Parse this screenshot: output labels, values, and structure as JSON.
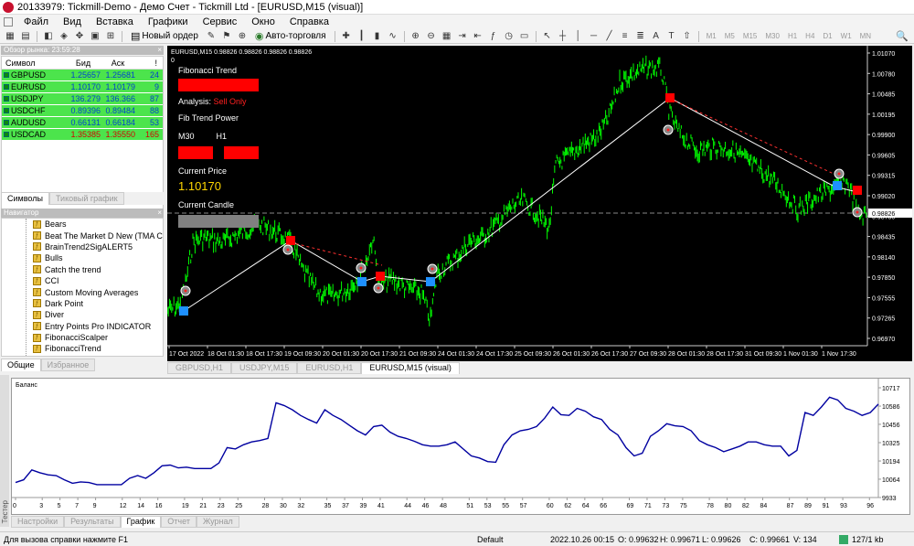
{
  "window": {
    "title": "20133979: Tickmill-Demo - Демо Счет - Tickmill Ltd - [EURUSD,M15 (visual)]"
  },
  "menu": [
    "Файл",
    "Вид",
    "Вставка",
    "Графики",
    "Сервис",
    "Окно",
    "Справка"
  ],
  "toolbar": {
    "new_order": "Новый ордер",
    "auto_trading": "Авто-торговля",
    "timeframes": [
      "M1",
      "M5",
      "M15",
      "M30",
      "H1",
      "H4",
      "D1",
      "W1",
      "MN"
    ]
  },
  "market_watch": {
    "header": "Обзор рынка: 23:59:28",
    "columns": [
      "Символ",
      "Бид",
      "Аск",
      "!"
    ],
    "rows": [
      {
        "symbol": "GBPUSD",
        "bid": "1.25657",
        "ask": "1.25681",
        "spread": "24",
        "dir": "up"
      },
      {
        "symbol": "EURUSD",
        "bid": "1.10170",
        "ask": "1.10179",
        "spread": "9",
        "dir": "up"
      },
      {
        "symbol": "USDJPY",
        "bid": "136.279",
        "ask": "136.366",
        "spread": "87",
        "dir": "up"
      },
      {
        "symbol": "USDCHF",
        "bid": "0.89396",
        "ask": "0.89484",
        "spread": "88",
        "dir": "up"
      },
      {
        "symbol": "AUDUSD",
        "bid": "0.66131",
        "ask": "0.66184",
        "spread": "53",
        "dir": "up"
      },
      {
        "symbol": "USDCAD",
        "bid": "1.35385",
        "ask": "1.35550",
        "spread": "165",
        "dir": "down"
      }
    ],
    "tabs": [
      "Символы",
      "Тиковый график"
    ]
  },
  "navigator": {
    "header": "Навигатор",
    "items": [
      "Bears",
      "Beat The Market D New (TMA C",
      "BrainTrend2SigALERT5",
      "Bulls",
      "Catch the trend",
      "CCI",
      "Custom Moving Averages",
      "Dark Point",
      "Diver",
      "Entry Points Pro INDICATOR",
      "FibonacciScalper",
      "FibonacciTrend"
    ],
    "tabs": [
      "Общие",
      "Избранное"
    ]
  },
  "chart": {
    "header": "EURUSD,M15  0.98826 0.98826 0.98826 0.98826",
    "header2": "0",
    "price_labels": [
      "1.01070",
      "1.00780",
      "1.00485",
      "1.00195",
      "0.99900",
      "0.99605",
      "0.99315",
      "0.99020",
      "0.98730",
      "0.98435",
      "0.98140",
      "0.97850",
      "0.97555",
      "0.97265",
      "0.96970"
    ],
    "current_price_label": "0.98826",
    "time_labels": [
      "17 Oct 2022",
      "18 Oct 01:30",
      "18 Oct 17:30",
      "19 Oct 09:30",
      "20 Oct 01:30",
      "20 Oct 17:30",
      "21 Oct 09:30",
      "24 Oct 01:30",
      "24 Oct 17:30",
      "25 Oct 09:30",
      "26 Oct 01:30",
      "26 Oct 17:30",
      "27 Oct 09:30",
      "28 Oct 01:30",
      "28 Oct 17:30",
      "31 Oct 09:30",
      "1 Nov 01:30",
      "1 Nov 17:30"
    ],
    "tabs": [
      "GBPUSD,H1",
      "USDJPY,M15",
      "EURUSD,H1",
      "EURUSD,M15 (visual)"
    ],
    "active_tab": 3
  },
  "indicator_panel": {
    "title": "Fibonacci Trend",
    "analysis_label": "Analysis:",
    "analysis_value": "Sell Only",
    "trend_power": "Fib Trend Power",
    "tf1": "M30",
    "tf2": "H1",
    "current_price_label": "Current Price",
    "current_price": "1.10170",
    "current_candle": "Current Candle",
    "colors": {
      "signal_red": "#ff0000",
      "price": "#ffd700",
      "candle_gray": "#808080"
    }
  },
  "balance_chart": {
    "title": "Баланс",
    "y_labels": [
      "10717",
      "10586",
      "10456",
      "10325",
      "10194",
      "10064",
      "9933"
    ],
    "x_labels": [
      "0",
      "3",
      "5",
      "7",
      "9",
      "12",
      "14",
      "16",
      "19",
      "21",
      "23",
      "25",
      "28",
      "30",
      "32",
      "35",
      "37",
      "39",
      "41",
      "44",
      "46",
      "48",
      "51",
      "53",
      "55",
      "57",
      "60",
      "62",
      "64",
      "66",
      "69",
      "71",
      "73",
      "75",
      "78",
      "80",
      "82",
      "84",
      "87",
      "89",
      "91",
      "93",
      "96"
    ],
    "tabs": [
      "Настройки",
      "Результаты",
      "График",
      "Отчет",
      "Журнал"
    ],
    "active_tab": 2,
    "side_label": "Тестер"
  },
  "chart_data": {
    "type": "line",
    "title": "Баланс",
    "ylim": [
      9933,
      10717
    ],
    "xlim": [
      0,
      97
    ],
    "series": [
      {
        "values": [
          10040,
          10060,
          10130,
          10110,
          10095,
          10090,
          10060,
          10035,
          10045,
          10040,
          10025,
          10025,
          10025,
          10025,
          10070,
          10090,
          10070,
          10110,
          10160,
          10165,
          10145,
          10150,
          10140,
          10140,
          10140,
          10180,
          10290,
          10280,
          10310,
          10330,
          10340,
          10355,
          10610,
          10590,
          10560,
          10520,
          10490,
          10465,
          10560,
          10520,
          10490,
          10450,
          10410,
          10380,
          10440,
          10450,
          10400,
          10370,
          10355,
          10335,
          10310,
          10300,
          10300,
          10310,
          10330,
          10280,
          10230,
          10215,
          10190,
          10185,
          10310,
          10380,
          10410,
          10420,
          10440,
          10500,
          10580,
          10525,
          10520,
          10570,
          10550,
          10510,
          10490,
          10420,
          10380,
          10290,
          10230,
          10250,
          10370,
          10410,
          10460,
          10445,
          10440,
          10410,
          10340,
          10310,
          10290,
          10260,
          10280,
          10300,
          10330,
          10330,
          10310,
          10300,
          10300,
          10230,
          10270,
          10540,
          10520,
          10580,
          10650,
          10630,
          10570,
          10550,
          10520,
          10540,
          10600
        ]
      }
    ]
  },
  "statusbar": {
    "help": "Для вызова справки нажмите F1",
    "profile": "Default",
    "datetime": "2022.10.26 00:15",
    "open": "O: 0.99632",
    "high": "H: 0.99671",
    "low": "L: 0.99626",
    "close": "C: 0.99661",
    "volume": "V: 134",
    "traffic": "127/1 kb"
  }
}
